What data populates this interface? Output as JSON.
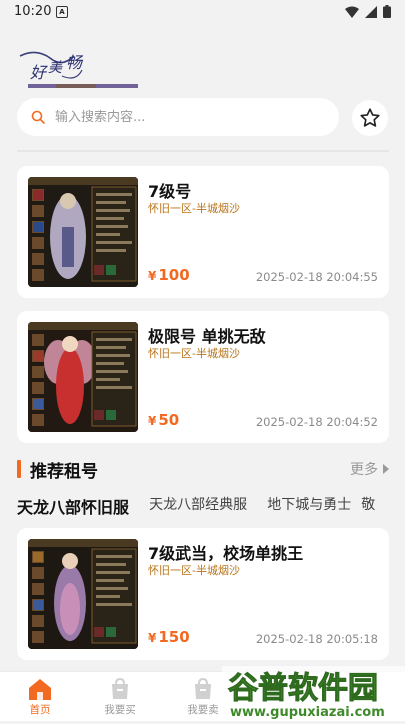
{
  "status": {
    "time": "10:20",
    "notif": "A"
  },
  "search": {
    "placeholder": "输入搜索内容..."
  },
  "listings": [
    {
      "title": "7级号",
      "server": "怀旧一区-半城烟沙",
      "currency": "¥",
      "price": "100",
      "time": "2025-02-18 20:04:55"
    },
    {
      "title": "极限号 单挑无敌",
      "server": "怀旧一区-半城烟沙",
      "currency": "¥",
      "price": "50",
      "time": "2025-02-18 20:04:52"
    }
  ],
  "recommend": {
    "title": "推荐租号",
    "more": "更多",
    "tabs": [
      "天龙八部怀旧服",
      "天龙八部经典服",
      "地下城与勇士",
      "敬"
    ],
    "items": [
      {
        "title": "7级武当，校场单挑王",
        "server": "怀旧一区-半城烟沙",
        "currency": "¥",
        "price": "150",
        "time": "2025-02-18 20:05:18"
      }
    ]
  },
  "nav": {
    "home": "首页",
    "buy": "我要买",
    "sell": "我要卖"
  },
  "watermark": {
    "main": "谷普软件园",
    "url": "www.gupuxiazai.com"
  },
  "colors": {
    "accent": "#f26a21",
    "server": "#b8741a"
  }
}
